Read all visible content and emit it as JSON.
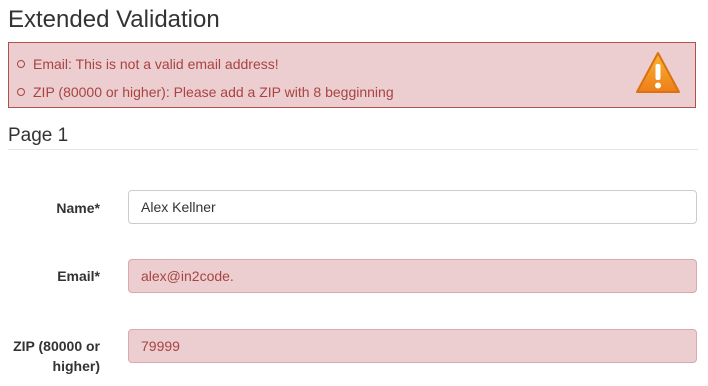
{
  "page": {
    "title": "Extended Validation"
  },
  "errors": {
    "items": [
      "Email: This is not a valid email address!",
      "ZIP (80000 or higher): Please add a ZIP with 8 begginning"
    ],
    "icon": "warning-icon"
  },
  "section": {
    "title": "Page 1"
  },
  "form": {
    "name": {
      "label": "Name*",
      "value": "Alex Kellner"
    },
    "email": {
      "label": "Email*",
      "value": "alex@in2code."
    },
    "zip": {
      "label_line1": "ZIP (80000 or",
      "label_line2": "higher)",
      "value": "79999"
    }
  },
  "colors": {
    "error_text": "#a94442",
    "error_background": "#eccdd0",
    "error_border": "#b05050",
    "warning_icon": "#f0941c"
  }
}
